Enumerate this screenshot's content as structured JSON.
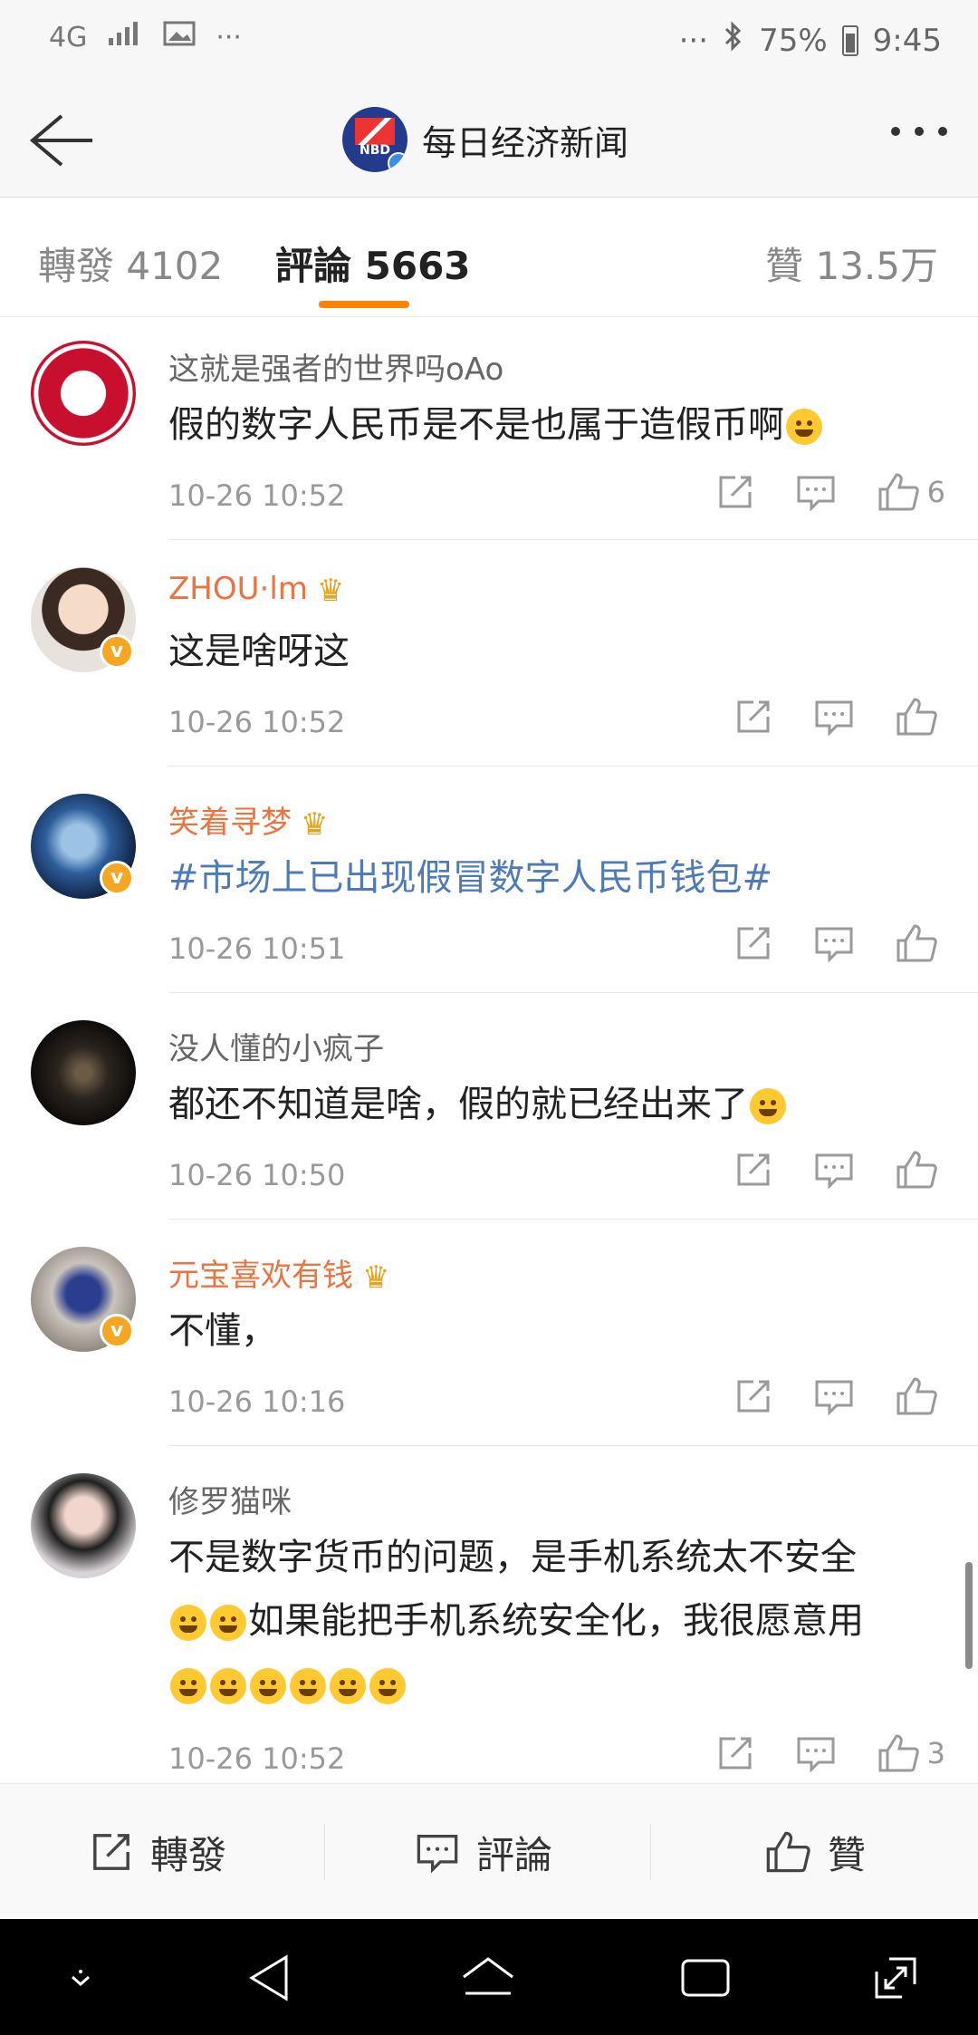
{
  "status_bar": {
    "network": "4G",
    "battery": "75%",
    "time": "9:45",
    "left_more": "···",
    "right_more": "···"
  },
  "header": {
    "account_name": "每日经济新闻",
    "logo_text": "NBD"
  },
  "tabs": [
    {
      "label": "轉發 4102"
    },
    {
      "label": "評論 5663"
    },
    {
      "label": "贊 13.5万"
    }
  ],
  "comments": [
    {
      "user": "这就是强者的世界吗oAo",
      "text": "假的数字人民币是不是也属于造假币啊",
      "time": "10-26 10:52",
      "likes": "6"
    },
    {
      "user": "ZHOU·lm",
      "text": "这是啥呀这",
      "time": "10-26 10:52",
      "likes": ""
    },
    {
      "user": "笑着寻梦",
      "text": "#市场上已出现假冒数字人民币钱包#",
      "time": "10-26 10:51",
      "likes": ""
    },
    {
      "user": "没人懂的小疯子",
      "text": "都还不知道是啥，假的就已经出来了",
      "time": "10-26 10:50",
      "likes": ""
    },
    {
      "user": "元宝喜欢有钱",
      "text": "不懂，",
      "time": "10-26 10:16",
      "likes": ""
    },
    {
      "user": "修罗猫咪",
      "text_line1": "不是数字货币的问题，是手机系统太不安全",
      "text_line2": "如果能把手机系统安全化，我很愿意用",
      "time": "10-26 10:52",
      "likes": "3"
    }
  ],
  "bottom_bar": {
    "repost": "轉發",
    "comment": "評論",
    "like": "贊"
  },
  "colors": {
    "accent": "#ff8200",
    "vip_name": "#eb7340",
    "topic": "#4e7ab7"
  }
}
